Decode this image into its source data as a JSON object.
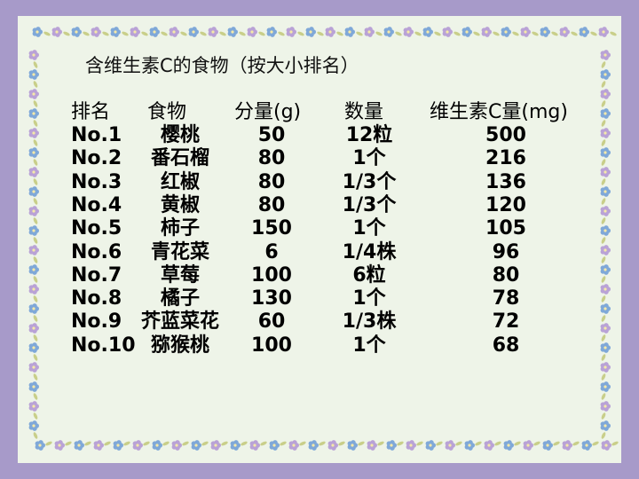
{
  "title": "含维生素C的食物（按大小排名）",
  "headers": [
    "排名",
    "食物",
    "分量(g)",
    "数量",
    "维生素C量(mg)"
  ],
  "rows": [
    [
      "No.1",
      "樱桃",
      "50",
      "12粒",
      "500"
    ],
    [
      "No.2",
      "番石榴",
      "80",
      "1个",
      "216"
    ],
    [
      "No.3",
      "红椒",
      "80",
      "1/3个",
      "136"
    ],
    [
      "No.4",
      "黄椒",
      "80",
      "1/3个",
      "120"
    ],
    [
      "No.5",
      "柿子",
      "150",
      "1个",
      "105"
    ],
    [
      "No.6",
      "青花菜",
      "6",
      "1/4株",
      "96"
    ],
    [
      "No.7",
      "草莓",
      "100",
      "6粒",
      "80"
    ],
    [
      "No.8",
      "橘子",
      "130",
      "1个",
      "78"
    ],
    [
      "No.9",
      "芥蓝菜花",
      "60",
      "1/3株",
      "72"
    ],
    [
      "No.10",
      "猕猴桃",
      "100",
      "1个",
      "68"
    ]
  ],
  "colors": {
    "background": "#a79ac9",
    "card": "#eef4e8",
    "flower_blue": "#7fa8d8",
    "flower_purple": "#b9a2d6",
    "vine": "#c9cf8a"
  },
  "decoration": "floral-vine-border-icon"
}
